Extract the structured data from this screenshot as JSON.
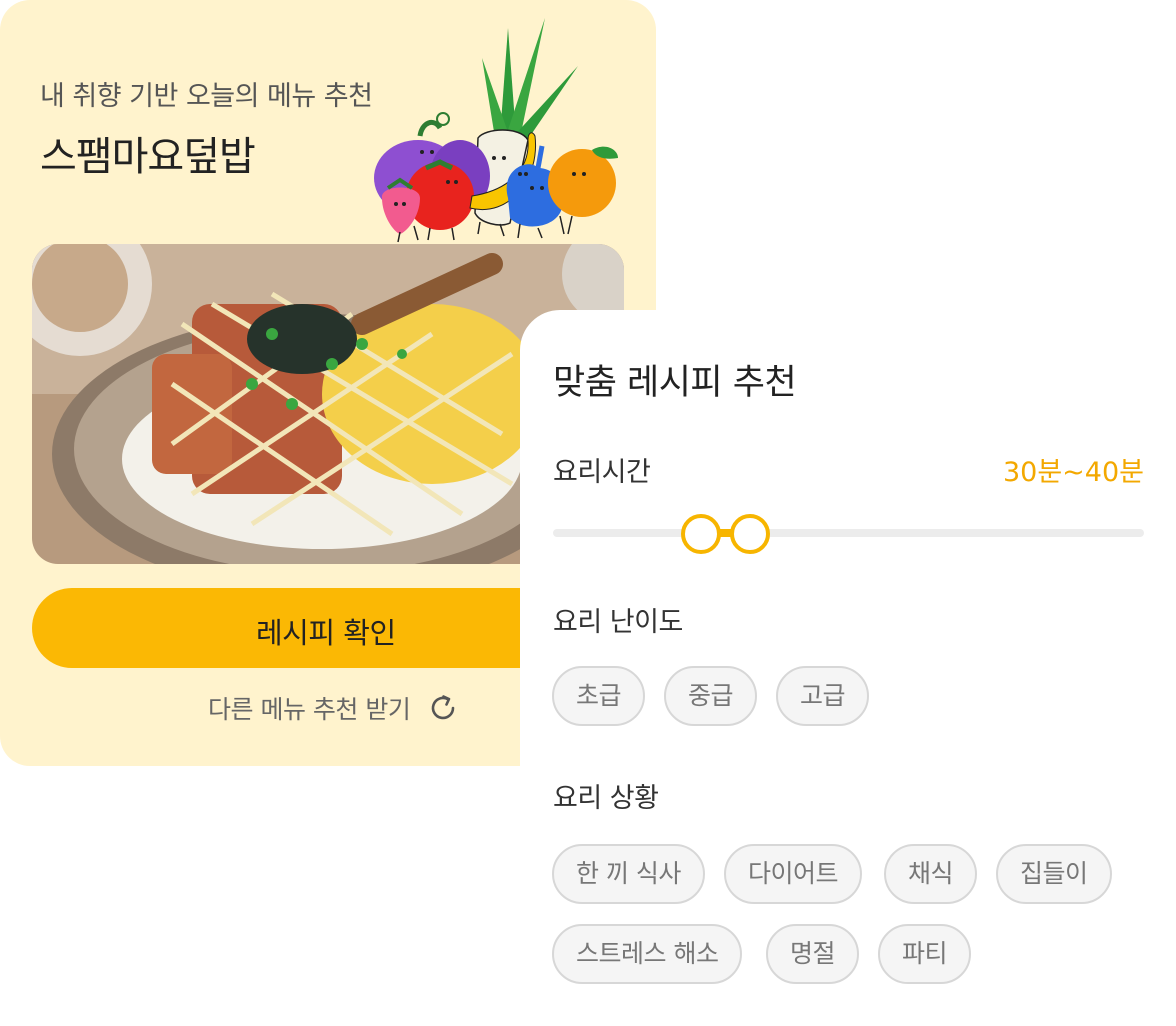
{
  "recommendation": {
    "subtitle": "내 취향 기반 오늘의 메뉴 추천",
    "menu_name": "스팸마요덮밥",
    "image_alt": "스팸마요덮밥",
    "cta_label": "레시피 확인",
    "refresh_label": "다른 메뉴 추천 받기"
  },
  "panel": {
    "title": "맞춤 레시피 추천",
    "cook_time": {
      "label": "요리시간",
      "value": "30분~40분",
      "range_min_minutes": 30,
      "range_max_minutes": 40
    },
    "difficulty": {
      "label": "요리 난이도",
      "options": [
        "초급",
        "중급",
        "고급"
      ]
    },
    "situation": {
      "label": "요리 상황",
      "options": [
        "한 끼 식사",
        "다이어트",
        "채식",
        "집들이",
        "스트레스 해소",
        "명절",
        "파티"
      ]
    }
  },
  "colors": {
    "card_background": "#fff3cd",
    "accent": "#fbb804",
    "accent_text": "#f3a800",
    "chip_border": "#d7d7d7"
  },
  "icons": {
    "refresh": "refresh-icon",
    "illustration": "vegetable-characters-illustration"
  }
}
